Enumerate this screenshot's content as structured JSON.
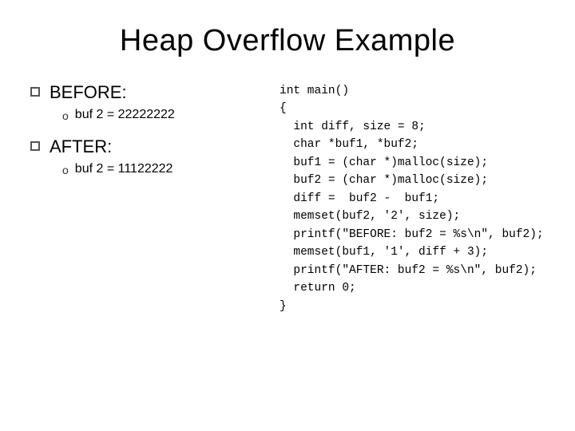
{
  "title": "Heap Overflow Example",
  "bullets": [
    {
      "label": "BEFORE:",
      "sub": "buf 2 = 22222222"
    },
    {
      "label": "AFTER:",
      "sub": "buf 2 = 11122222"
    }
  ],
  "code": "int main()\n{\n  int diff, size = 8;\n  char *buf1, *buf2;\n  buf1 = (char *)malloc(size);\n  buf2 = (char *)malloc(size);\n  diff =  buf2 -  buf1;\n  memset(buf2, '2', size);\n  printf(\"BEFORE: buf2 = %s\\n\", buf2);\n  memset(buf1, '1', diff + 3);\n  printf(\"AFTER: buf2 = %s\\n\", buf2);\n  return 0;\n}"
}
